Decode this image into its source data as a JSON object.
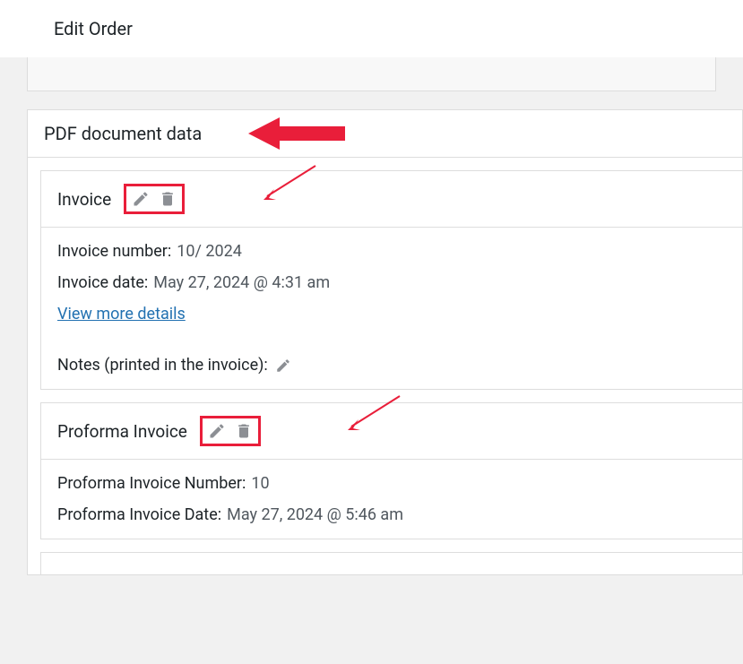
{
  "header": {
    "title": "Edit Order"
  },
  "section": {
    "title": "PDF document data"
  },
  "invoice": {
    "title": "Invoice",
    "number_label": "Invoice number:",
    "number_value": "10/ 2024",
    "date_label": "Invoice date:",
    "date_value": "May 27, 2024 @ 4:31 am",
    "view_more": "View more details",
    "notes_label": "Notes (printed in the invoice):"
  },
  "proforma": {
    "title": "Proforma Invoice",
    "number_label": "Proforma Invoice Number:",
    "number_value": "10",
    "date_label": "Proforma Invoice Date:",
    "date_value": "May 27, 2024 @ 5:46 am"
  }
}
